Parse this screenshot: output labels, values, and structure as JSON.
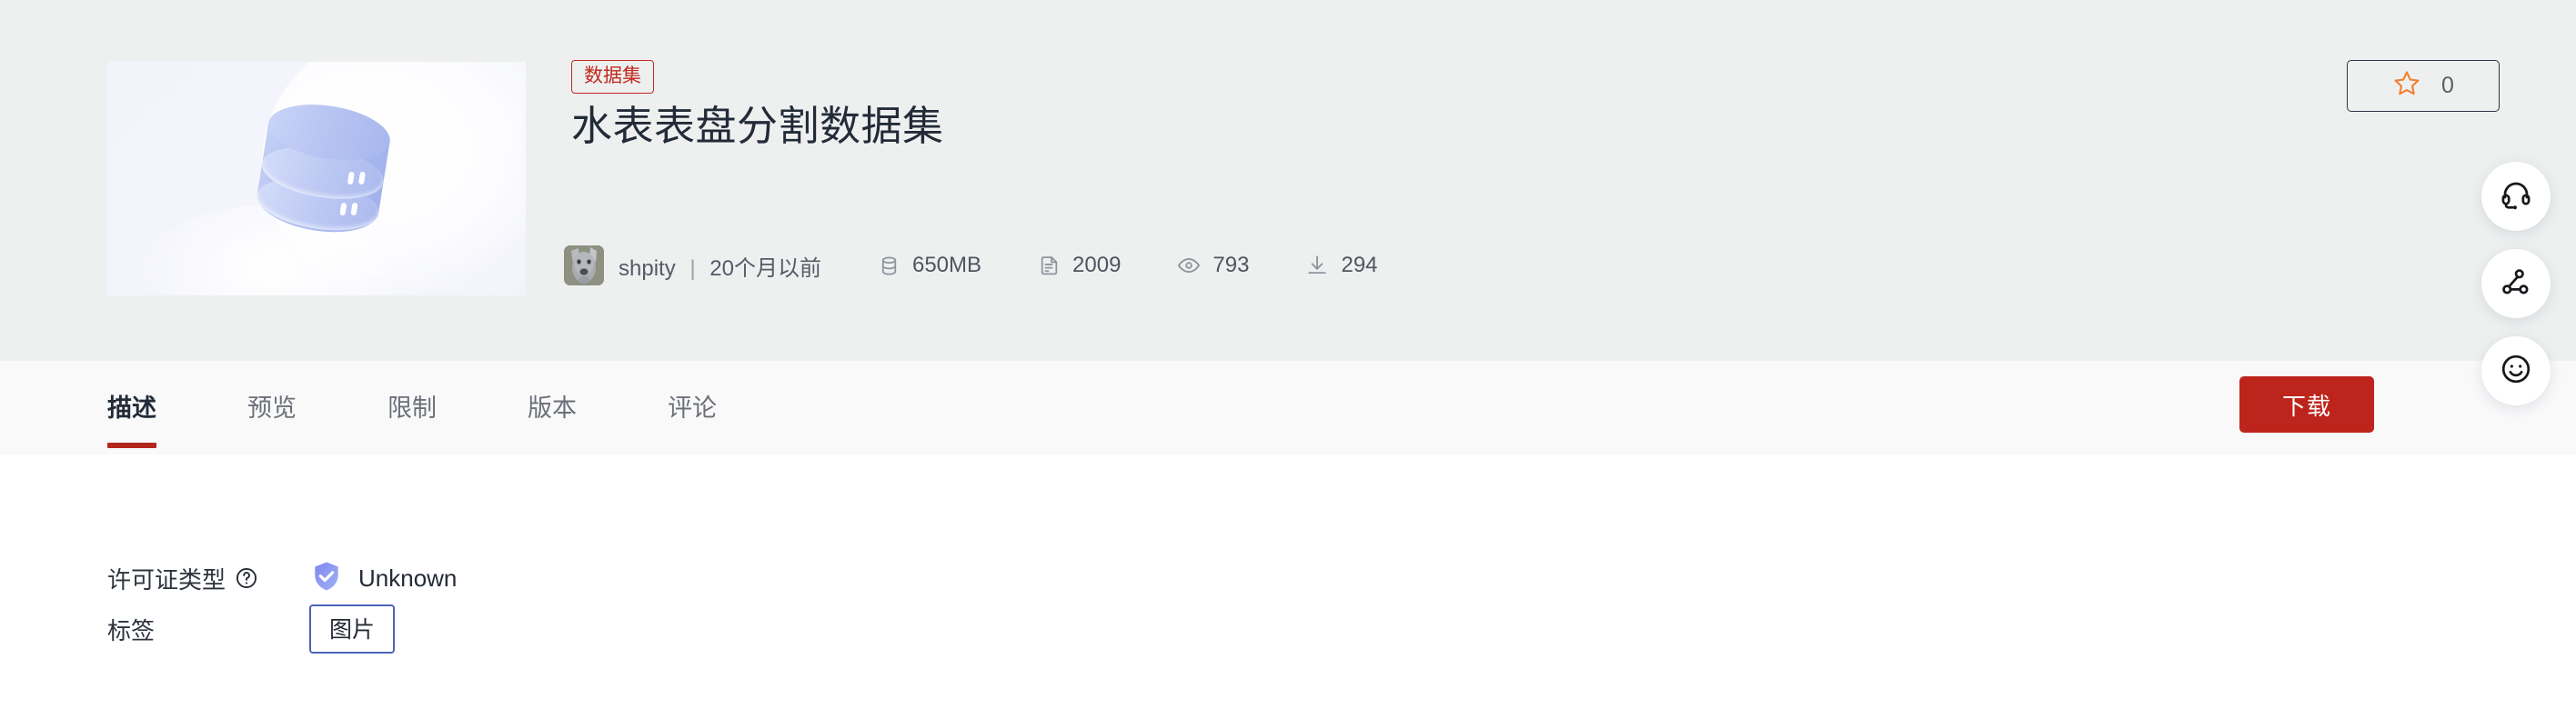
{
  "header": {
    "badge_label": "数据集",
    "title": "水表表盘分割数据集",
    "thumbnail_alt": "database-illustration",
    "owner": "shpity",
    "separator": "|",
    "updated": "20个月以前",
    "stats": [
      {
        "icon": "database-icon",
        "value": "650MB"
      },
      {
        "icon": "file-icon",
        "value": "2009"
      },
      {
        "icon": "eye-icon",
        "value": "793"
      },
      {
        "icon": "download-icon",
        "value": "294"
      }
    ],
    "star": {
      "icon": "star-icon",
      "count": "0"
    }
  },
  "tabs": [
    {
      "label": "描述",
      "active": true
    },
    {
      "label": "预览",
      "active": false
    },
    {
      "label": "限制",
      "active": false
    },
    {
      "label": "版本",
      "active": false
    },
    {
      "label": "评论",
      "active": false
    }
  ],
  "download_button": {
    "label": "下载"
  },
  "content": {
    "license": {
      "label": "许可证类型",
      "help_icon": "question-circle-icon",
      "shield_icon": "shield-check-icon",
      "value": "Unknown"
    },
    "tags": {
      "label": "标签",
      "items": [
        "图片"
      ]
    }
  },
  "fabs": [
    {
      "icon": "headset-icon",
      "name": "support"
    },
    {
      "icon": "share-nodes-icon",
      "name": "share"
    },
    {
      "icon": "smiley-icon",
      "name": "feedback"
    }
  ],
  "colors": {
    "header_bg": "#eef0f0",
    "tabbar_bg": "#f9f9fa",
    "brand_red": "#bd241b",
    "badge_red": "#c0291e",
    "tag_blue": "#4c63b6",
    "star_orange": "#ef8133",
    "shield_blue": "#7b8ff0",
    "title_dark": "#232b38"
  }
}
